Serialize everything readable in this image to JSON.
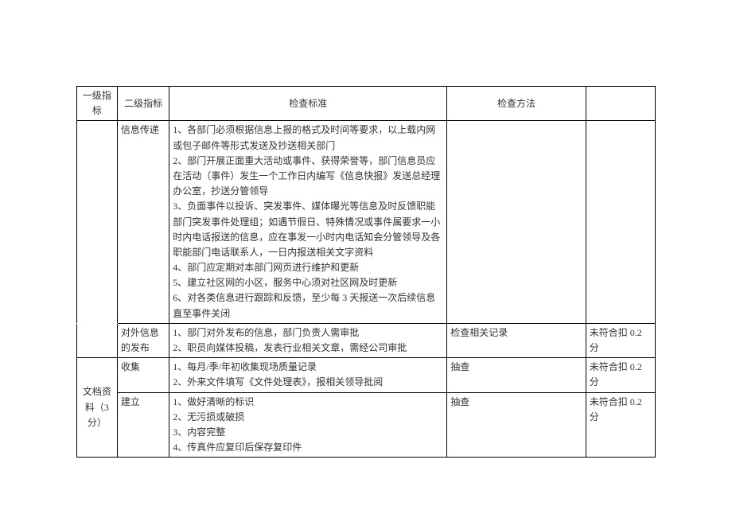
{
  "headers": {
    "col1": "一级指标",
    "col2": "二级指标",
    "col3": "检查标准",
    "col4": "检查方法",
    "col5": ""
  },
  "rows": [
    {
      "level1": "",
      "level2": "信息传递",
      "standard": "1、各部门必须根据信息上报的格式及时间等要求，以上载内网或包子邮件等形式发送及抄送相关部门\n2、部门开展正面重大活动或事件、获得荣誉等，部门信息员应在活动（事件）发生一个工作日内编写《信息快报》发送总经理办公室，抄送分管领导\n3、负面事件以投诉、突发事件、媒体曝光等信息及时反馈职能部门突发事件处理组；如遇节假日、特殊情况或事件属要求一小时内电话报送的信息，应在事发一小时内电话知会分管领导及各职能部门电话联系人，一日内报送相关文字资料\n4、部门应定期对本部门网页进行维护和更新\n5、建立社区网的小区，服务中心须对社区网及时更新\n6、对各类信息进行跟踪和反馈，至少每 3 天报送一次后续信息直至事件关闭",
      "method": "",
      "deduction": ""
    },
    {
      "level1": "",
      "level2": "对外信息的发布",
      "standard": "1、部门对外发布的信息，部门负责人需审批\n2、职员向媒体投稿，发表行业相关文章，需经公司审批",
      "method": "检查相关记录",
      "deduction": "未符合扣 0.2 分"
    },
    {
      "level1": "文档资料（3 分）",
      "level2": "收集",
      "standard": "1、每月/季/年初收集现场质量记录\n2、外来文件填写《文件处理表》，报相关领导批阅",
      "method": "抽查",
      "deduction": "未符合扣 0.2 分"
    },
    {
      "level1": "",
      "level2": "建立",
      "standard": "1、做好清晰的标识\n2、无污损或破损\n3、内容完整\n4、传真件应复印后保存复印件",
      "method": "抽查",
      "deduction": "未符合扣 0.2 分"
    }
  ]
}
